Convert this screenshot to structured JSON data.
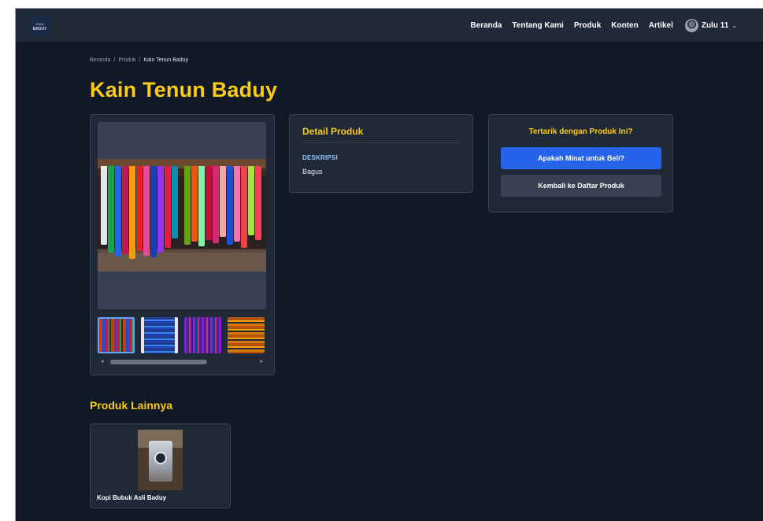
{
  "navbar": {
    "logo_text": "BADUY",
    "logo_small": "KAIN",
    "links": [
      "Beranda",
      "Tentang Kami",
      "Produk",
      "Konten",
      "Artikel"
    ],
    "user_name": "Zulu 11",
    "dropdown_icon": "chevron-down-icon"
  },
  "breadcrumb": {
    "items": [
      "Beranda",
      "Produk"
    ],
    "separator": "/",
    "current": "Kain Tenun Baduy"
  },
  "page": {
    "title": "Kain Tenun Baduy"
  },
  "gallery": {
    "thumbnail_count": 4,
    "active_thumbnail": 1,
    "scroll_left_icon": "◂",
    "scroll_right_icon": "▸"
  },
  "detail": {
    "title": "Detail Produk",
    "description_label": "DESKRIPSI",
    "description_value": "Bagus"
  },
  "cta": {
    "title": "Tertarik dengan Produk Ini?",
    "primary_button": "Apakah Minat untuk Beli?",
    "secondary_button": "Kembali ke Daftar Produk"
  },
  "other_products": {
    "title": "Produk Lainnya",
    "items": [
      {
        "name": "Kopi Bubuk Asli Baduy"
      }
    ]
  },
  "colors": {
    "background": "#111827",
    "card": "#1f2937",
    "accent": "#facc15",
    "primary": "#2563eb"
  }
}
